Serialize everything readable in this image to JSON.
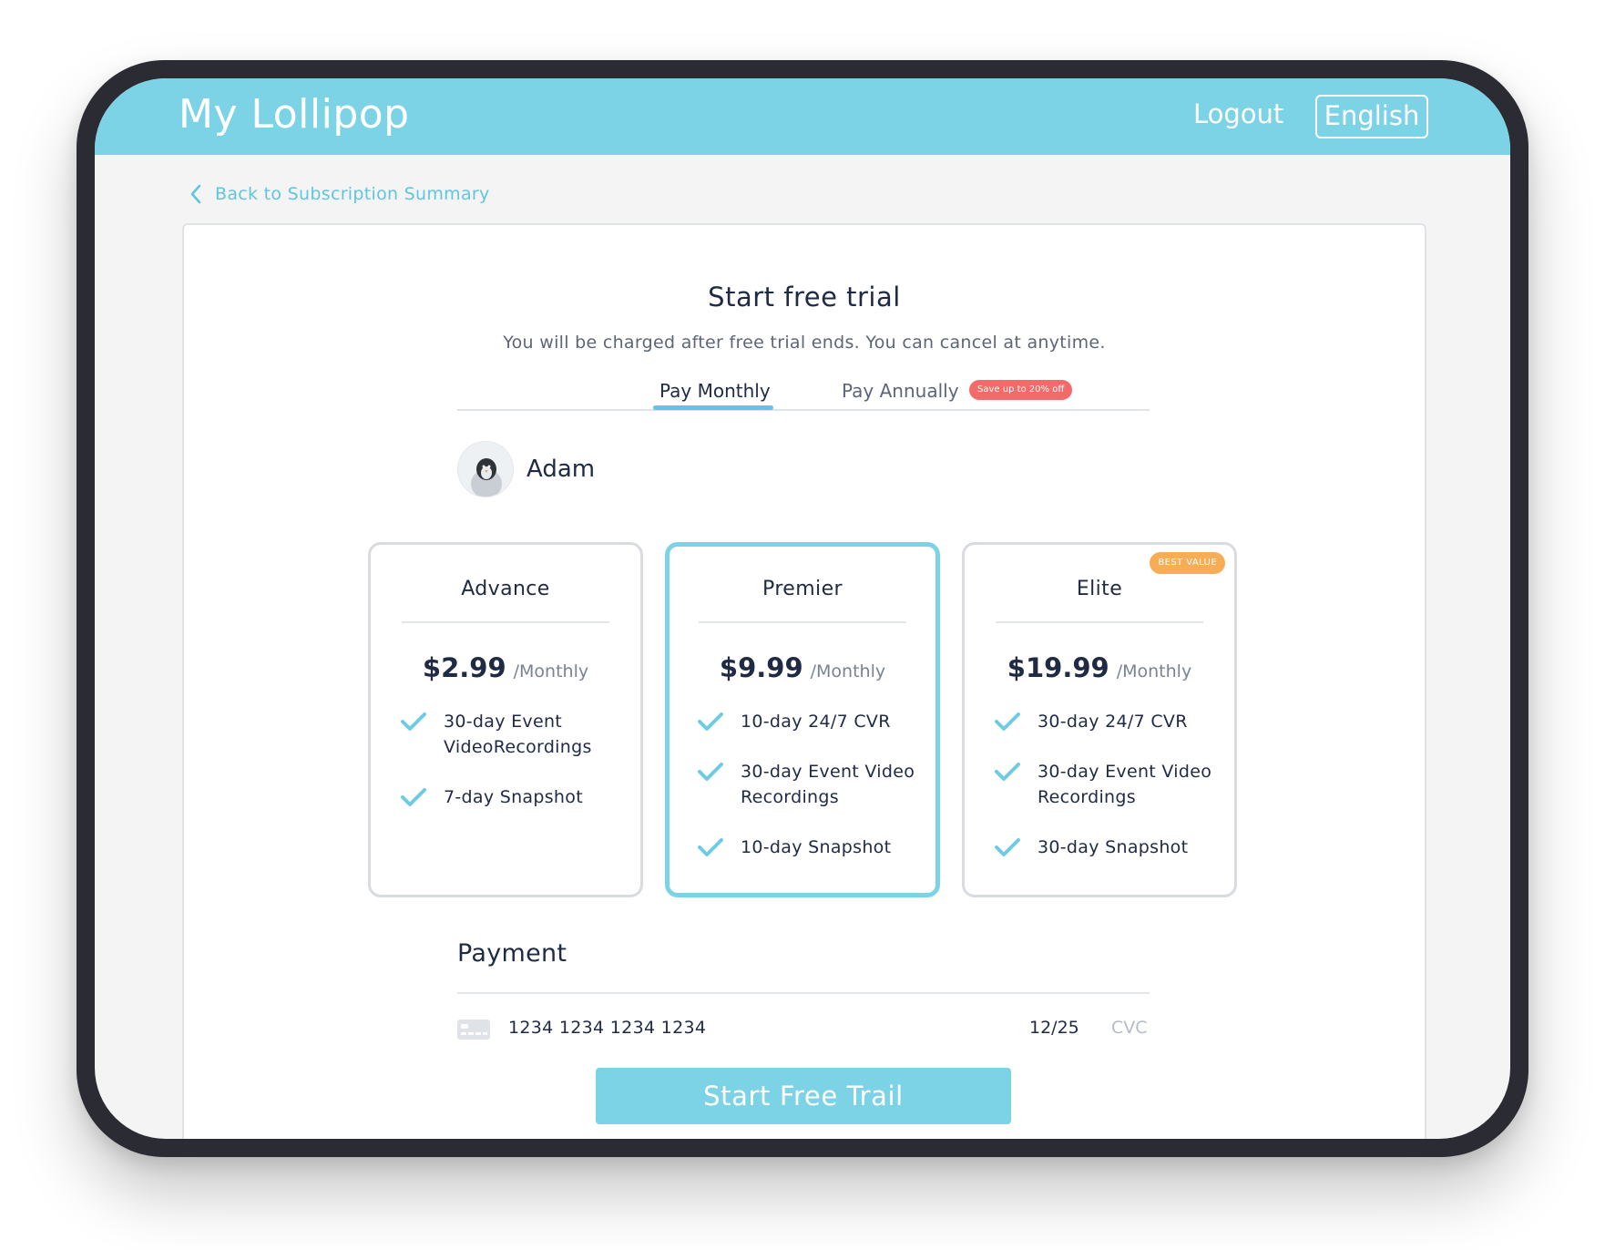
{
  "header": {
    "brand": "My Lollipop",
    "logout_label": "Logout",
    "language_label": "English",
    "background_color": "#7dd3e6"
  },
  "back_link": {
    "icon": "chevron-left-icon",
    "label": "Back to Subscription Summary"
  },
  "trial": {
    "title": "Start free trial",
    "subtitle": "You will be charged after free trial ends. You can cancel at anytime."
  },
  "billing_tabs": {
    "tabs": [
      {
        "label": "Pay Monthly",
        "selected": true
      },
      {
        "label": "Pay Annually",
        "selected": false
      }
    ],
    "save_badge": "Save up to 20% off"
  },
  "profile": {
    "name": "Adam",
    "avatar": "penguin-avatar"
  },
  "plans": [
    {
      "name": "Advance",
      "price": "$2.99",
      "period": "/Monthly",
      "selected": false,
      "features": [
        "30-day Event VideoRecordings",
        "7-day Snapshot"
      ]
    },
    {
      "name": "Premier",
      "price": "$9.99",
      "period": "/Monthly",
      "selected": true,
      "features": [
        "10-day 24/7 CVR",
        "30-day Event Video Recordings",
        "10-day Snapshot"
      ]
    },
    {
      "name": "Elite",
      "price": "$19.99",
      "period": "/Monthly",
      "selected": false,
      "badge": "BEST VALUE",
      "features": [
        "30-day 24/7 CVR",
        "30-day Event Video Recordings",
        "30-day Snapshot"
      ]
    }
  ],
  "payment": {
    "title": "Payment",
    "card_icon": "credit-card-icon",
    "card_number": "1234 1234 1234 1234",
    "expiry": "12/25",
    "cvc_placeholder": "CVC"
  },
  "cta_label": "Start Free Trail",
  "colors": {
    "accent": "#7dd3e6",
    "link": "#5fc6e0",
    "save_badge": "#f26a6a",
    "best_value_badge": "#f7ad55",
    "text_dark": "#1f2a44"
  }
}
